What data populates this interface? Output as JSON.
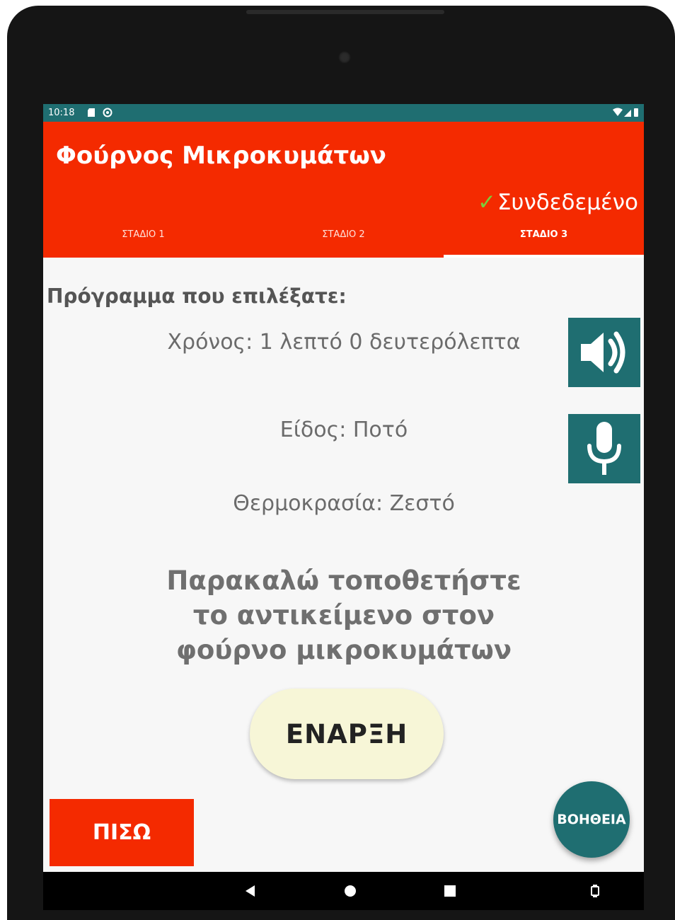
{
  "status_bar": {
    "time": "10:18"
  },
  "app_bar": {
    "title": "Φούρνος Μικροκυμάτων",
    "connection_check": "✓",
    "connection_status": "Συνδεδεμένο",
    "check_color": "#7ccc3a",
    "background_color": "#f42a00"
  },
  "tabs": [
    {
      "label": "ΣΤΑΔΙΟ 1",
      "active": false
    },
    {
      "label": "ΣΤΑΔΙΟ 2",
      "active": false
    },
    {
      "label": "ΣΤΑΔΙΟ 3",
      "active": true
    }
  ],
  "program": {
    "label": "Πρόγραμμα που επιλέξατε:",
    "time": "Χρόνος: 1 λεπτό 0 δευτερόλεπτα",
    "kind": "Είδος: Ποτό",
    "temperature": "Θερμοκρασία: Ζεστό"
  },
  "instruction": "Παρακαλώ τοποθετήστε το αντικείμενο στον φούρνο μικροκυμάτων",
  "side_buttons": {
    "speaker_icon": "speaker-icon",
    "mic_icon": "microphone-icon",
    "color": "#1f6e71"
  },
  "buttons": {
    "start": "ΕΝΑΡΞΗ",
    "back": "ΠΙΣΩ",
    "help": "ΒΟΗΘΕΙΑ"
  },
  "nav_bar": {
    "back_icon": "nav-back-icon",
    "home_icon": "nav-home-icon",
    "recents_icon": "nav-recents-icon",
    "rotate_icon": "rotate-icon"
  }
}
